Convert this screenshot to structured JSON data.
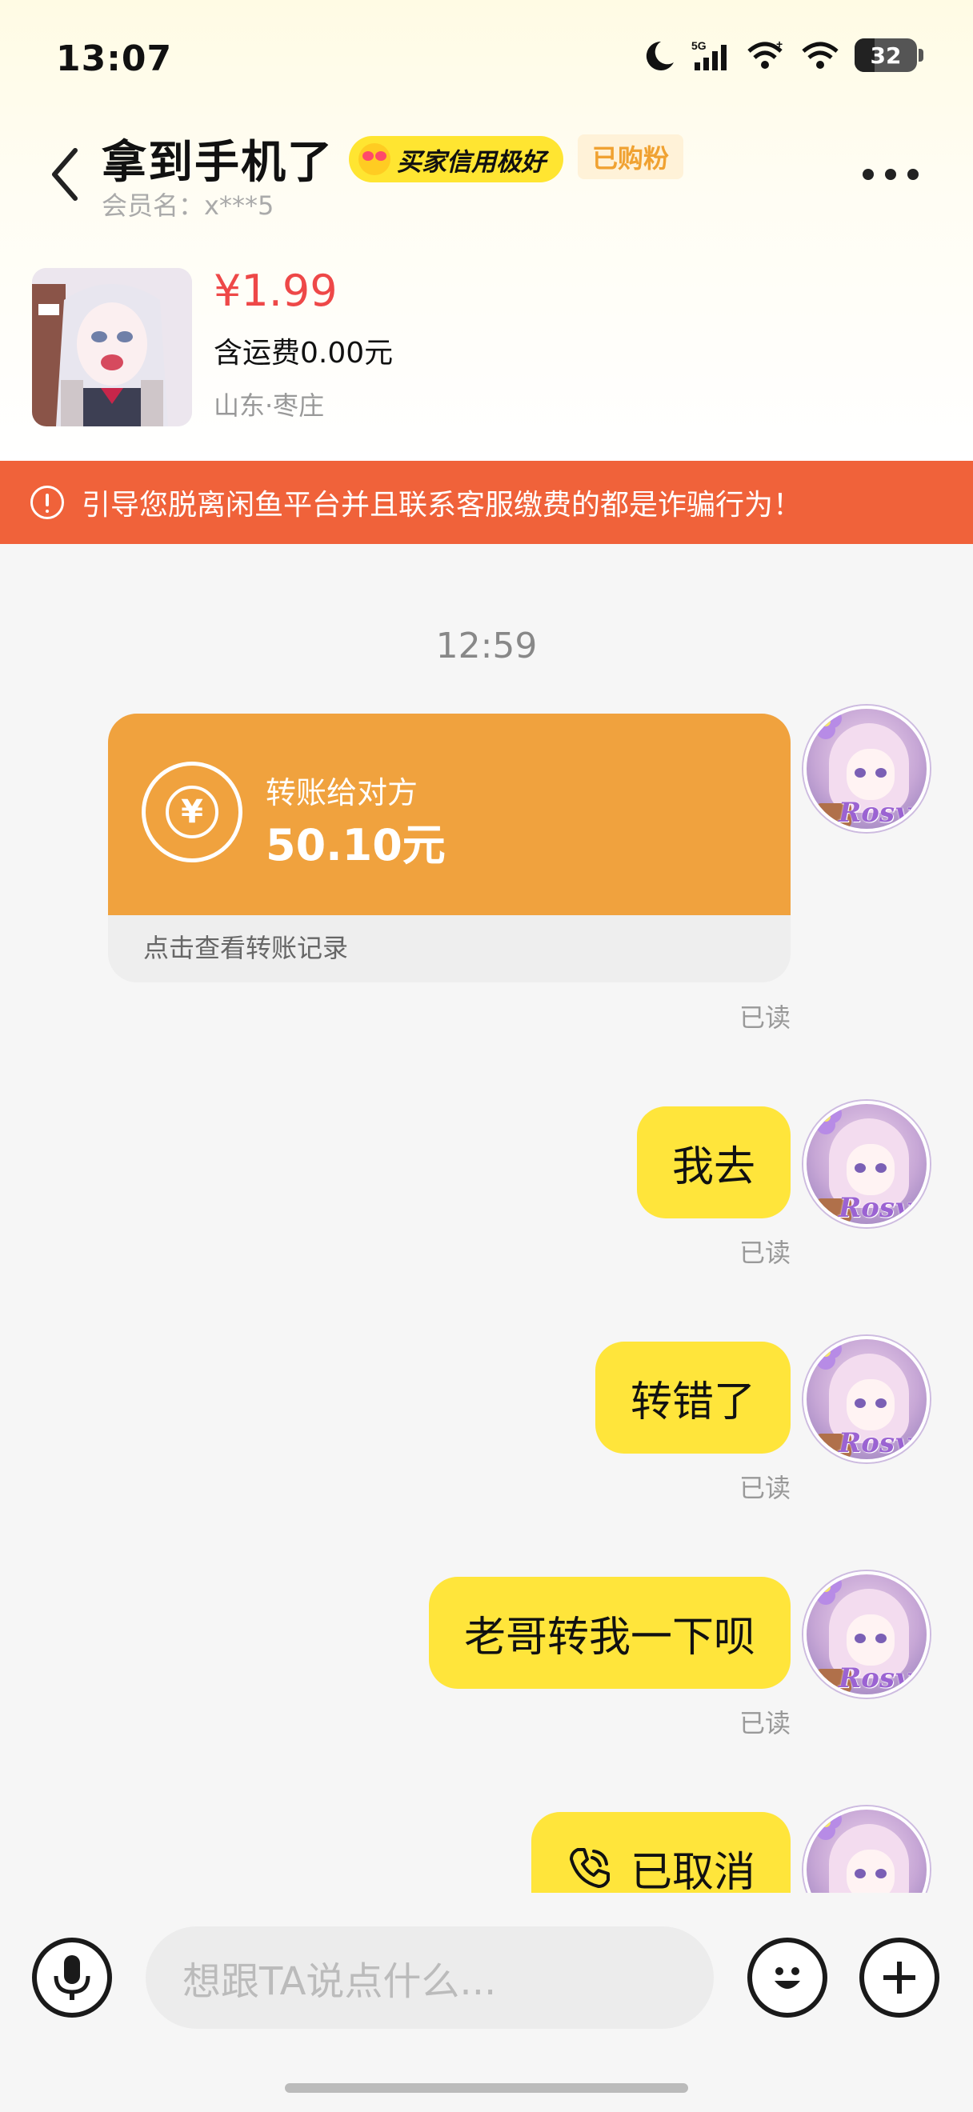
{
  "status_bar": {
    "time": "13:07",
    "network": "5G",
    "battery_level": "32",
    "battery_fraction": 0.32,
    "icons": [
      "moon-icon",
      "signal-5g-icon",
      "wifi-plus-icon",
      "wifi-icon",
      "battery-icon"
    ]
  },
  "header": {
    "title": "拿到手机了",
    "credit_badge": "买家信用极好",
    "fan_badge": "已购粉",
    "member_name": "会员名：x***5"
  },
  "product": {
    "price": "¥1.99",
    "shipping": "含运费0.00元",
    "location": "山东·枣庄"
  },
  "warning": {
    "text": "引导您脱离闲鱼平台并且联系客服缴费的都是诈骗行为！"
  },
  "chat": {
    "timestamp": "12:59",
    "avatar_label": "Rosy",
    "messages": [
      {
        "type": "transfer",
        "label": "转账给对方",
        "amount": "50.10元",
        "link": "点击查看转账记录",
        "status": "已读"
      },
      {
        "type": "text",
        "text": "我去",
        "status": "已读"
      },
      {
        "type": "text",
        "text": "转错了",
        "status": "已读"
      },
      {
        "type": "text",
        "text": "老哥转我一下呗",
        "status": "已读"
      },
      {
        "type": "call",
        "text": "已取消"
      }
    ]
  },
  "input": {
    "placeholder": "想跟TA说点什么..."
  },
  "colors": {
    "bubble": "#ffe53b",
    "transfer": "#f0a23e",
    "warning": "#f0623a",
    "price": "#ee4848"
  }
}
